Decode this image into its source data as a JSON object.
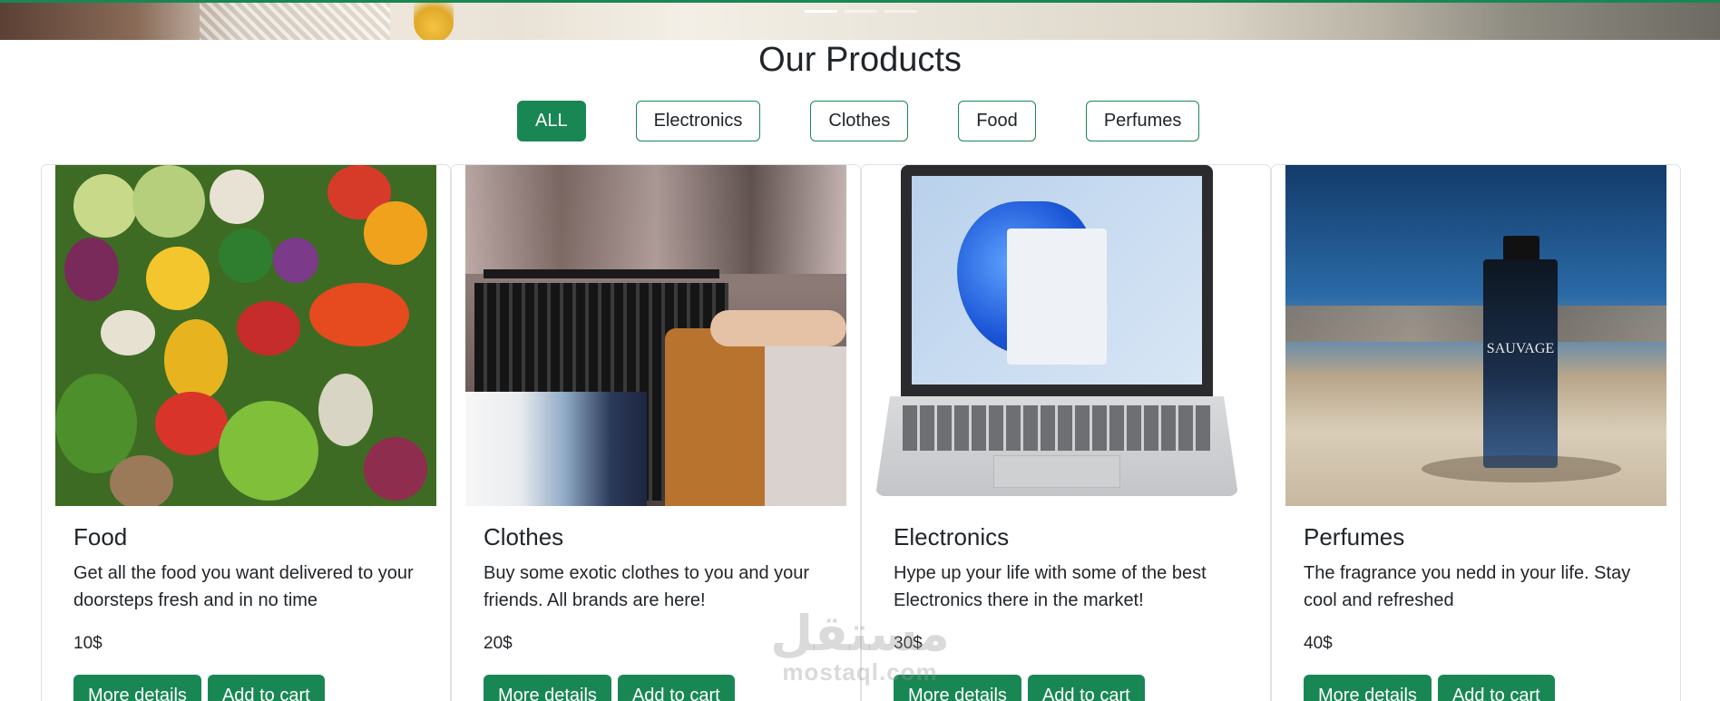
{
  "section": {
    "title": "Our Products"
  },
  "filters": [
    {
      "label": "ALL",
      "active": true
    },
    {
      "label": "Electronics",
      "active": false
    },
    {
      "label": "Clothes",
      "active": false
    },
    {
      "label": "Food",
      "active": false
    },
    {
      "label": "Perfumes",
      "active": false
    }
  ],
  "cards": [
    {
      "title": "Food",
      "text": "Get all the food you want delivered to your doorsteps fresh and in no time",
      "price": "10$",
      "details_label": "More details",
      "cart_label": "Add to cart"
    },
    {
      "title": "Clothes",
      "text": "Buy some exotic clothes to you and your friends. All brands are here!",
      "price": "20$",
      "details_label": "More details",
      "cart_label": "Add to cart"
    },
    {
      "title": "Electronics",
      "text": "Hype up your life with some of the best Electronics there in the market!",
      "price": "30$",
      "details_label": "More details",
      "cart_label": "Add to cart"
    },
    {
      "title": "Perfumes",
      "text": "The fragrance you nedd in your life. Stay cool and refreshed",
      "price": "40$",
      "details_label": "More details",
      "cart_label": "Add to cart"
    }
  ],
  "images": {
    "perfume_bottle_label": "SAUVAGE"
  },
  "watermark": {
    "arabic": "مستقل",
    "latin": "mostaql.com"
  },
  "colors": {
    "accent": "#198754"
  }
}
